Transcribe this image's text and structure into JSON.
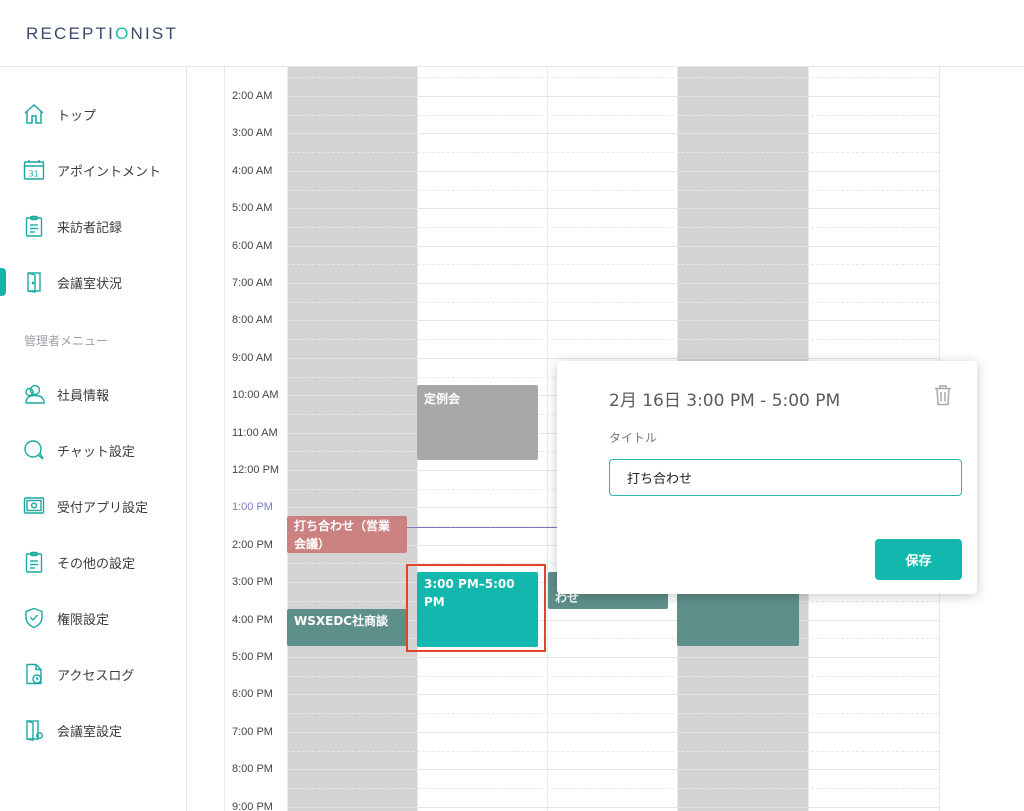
{
  "header": {
    "logo_main": "RECEPTI",
    "logo_accent": "O",
    "logo_rest": "NIST"
  },
  "sidebar": {
    "items": [
      {
        "label": "トップ",
        "icon": "home-icon"
      },
      {
        "label": "アポイントメント",
        "icon": "calendar-icon"
      },
      {
        "label": "来訪者記録",
        "icon": "clipboard-icon"
      },
      {
        "label": "会議室状況",
        "icon": "door-icon",
        "active": true
      }
    ],
    "admin_label": "管理者メニュー",
    "admin_items": [
      {
        "label": "社員情報",
        "icon": "users-icon"
      },
      {
        "label": "チャット設定",
        "icon": "chat-icon"
      },
      {
        "label": "受付アプリ設定",
        "icon": "tablet-gear-icon"
      },
      {
        "label": "その他の設定",
        "icon": "clipboard-icon"
      },
      {
        "label": "権限設定",
        "icon": "shield-icon"
      },
      {
        "label": "アクセスログ",
        "icon": "file-clock-icon"
      },
      {
        "label": "会議室設定",
        "icon": "door-gear-icon"
      }
    ]
  },
  "calendar": {
    "times": [
      "2:00 AM",
      "3:00 AM",
      "4:00 AM",
      "5:00 AM",
      "6:00 AM",
      "7:00 AM",
      "8:00 AM",
      "9:00 AM",
      "10:00 AM",
      "11:00 AM",
      "12:00 PM",
      "1:00 PM",
      "2:00 PM",
      "3:00 PM",
      "4:00 PM",
      "5:00 PM",
      "6:00 PM",
      "7:00 PM",
      "8:00 PM",
      "9:00 PM"
    ],
    "current_time_label": "1:00 PM",
    "events": {
      "teirei": "定例会",
      "uchiawase_eigyo": "打ち合わせ（営業会議）",
      "wsxedc": "WSXEDC社商談",
      "selected": "3:00 PM–5:00 PM",
      "partial": "わせ"
    }
  },
  "popup": {
    "date_range": "2月 16日 3:00 PM - 5:00 PM",
    "title_label": "タイトル",
    "title_value": "打ち合わせ",
    "save_label": "保存",
    "trash_icon": "trash-icon"
  },
  "colors": {
    "accent": "#12b8ad",
    "busy_column": "#d4d4d4",
    "event_gray": "#a8a8a8",
    "event_red": "#cc8181",
    "event_dark_teal": "#5f8f8b",
    "selection_border": "#e0452c"
  }
}
